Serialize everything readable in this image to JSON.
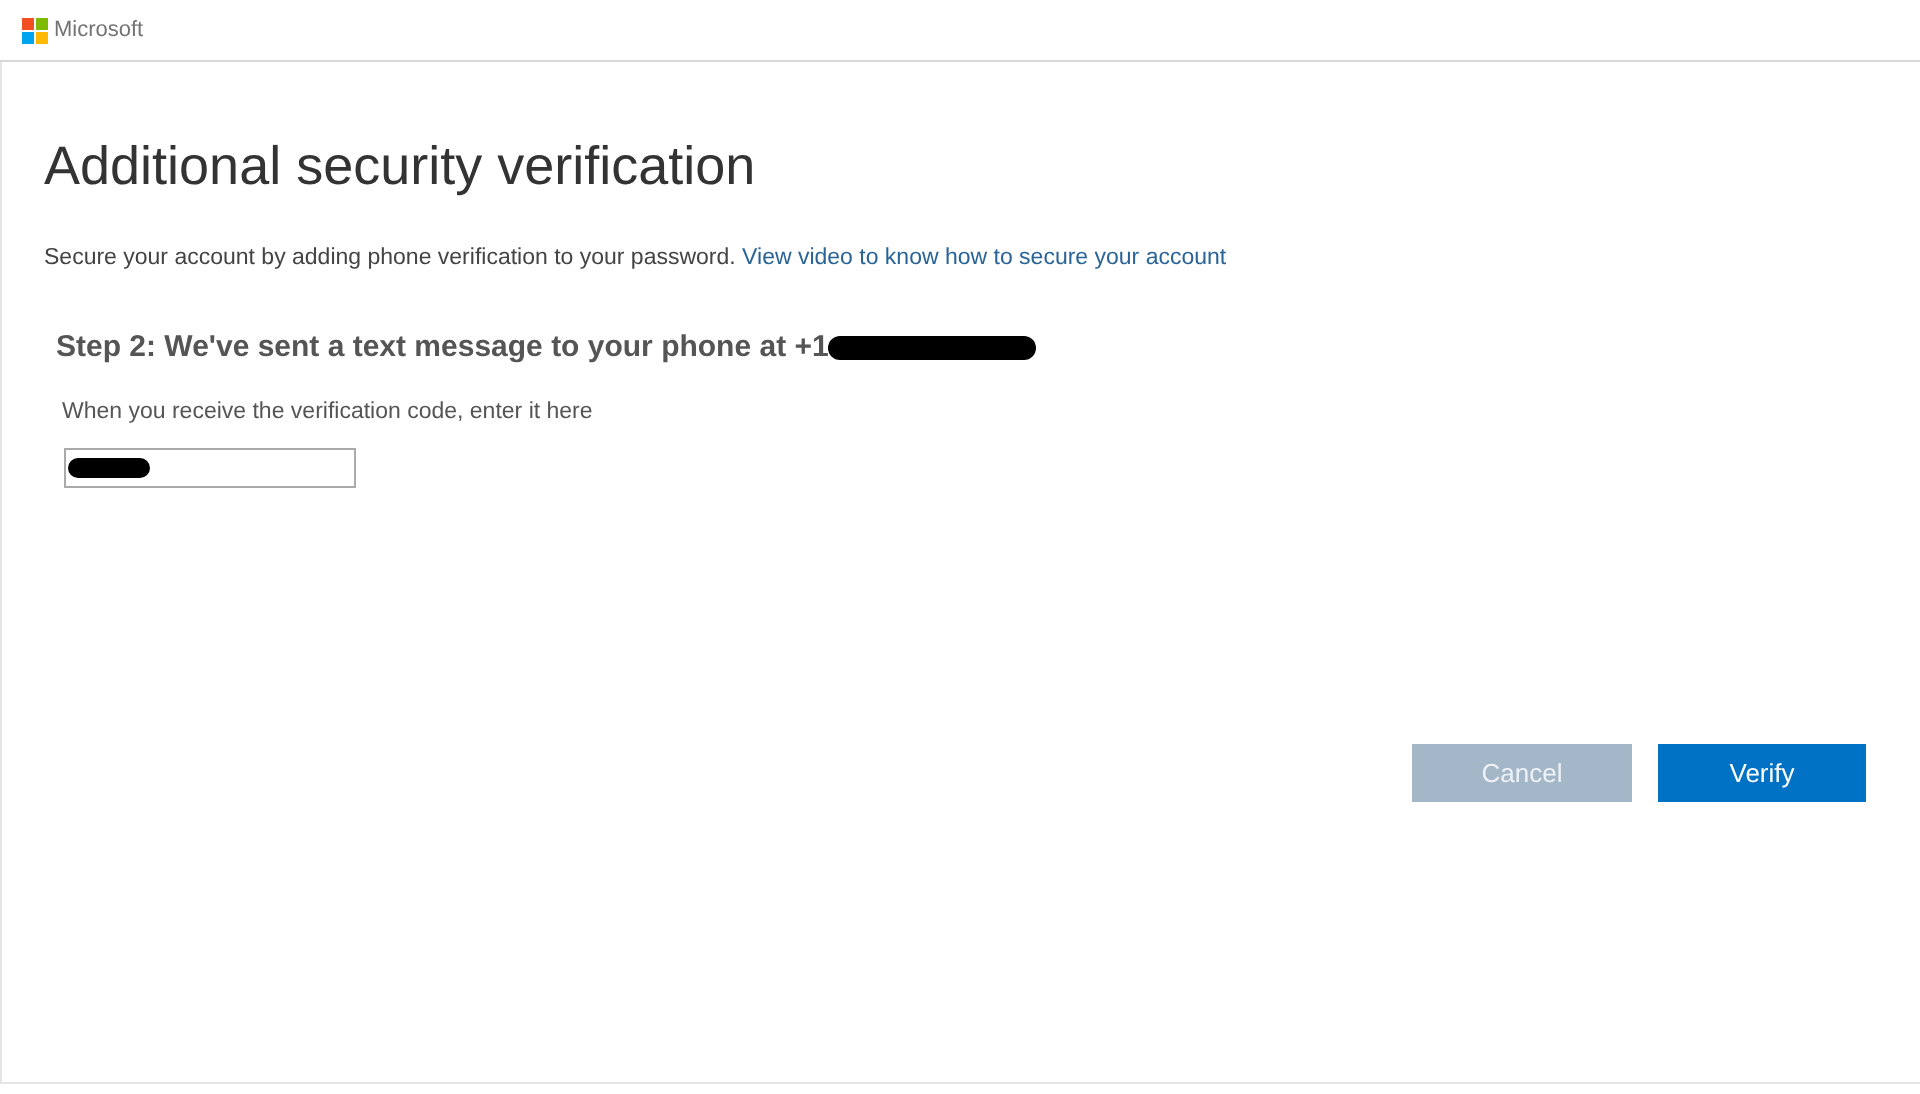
{
  "header": {
    "brand": "Microsoft"
  },
  "title": "Additional security verification",
  "intro": {
    "text": "Secure your account by adding phone verification to your password.",
    "link": "View video to know how to secure your account"
  },
  "step": {
    "heading": "Step 2: We've sent a text message to your phone at +1",
    "redacted": true
  },
  "code_field": {
    "label": "When you receive the verification code, enter it here",
    "redacted": true
  },
  "buttons": [
    {
      "label": "Cancel",
      "disabled": true
    },
    {
      "label": "Verify",
      "disabled": false
    }
  ]
}
